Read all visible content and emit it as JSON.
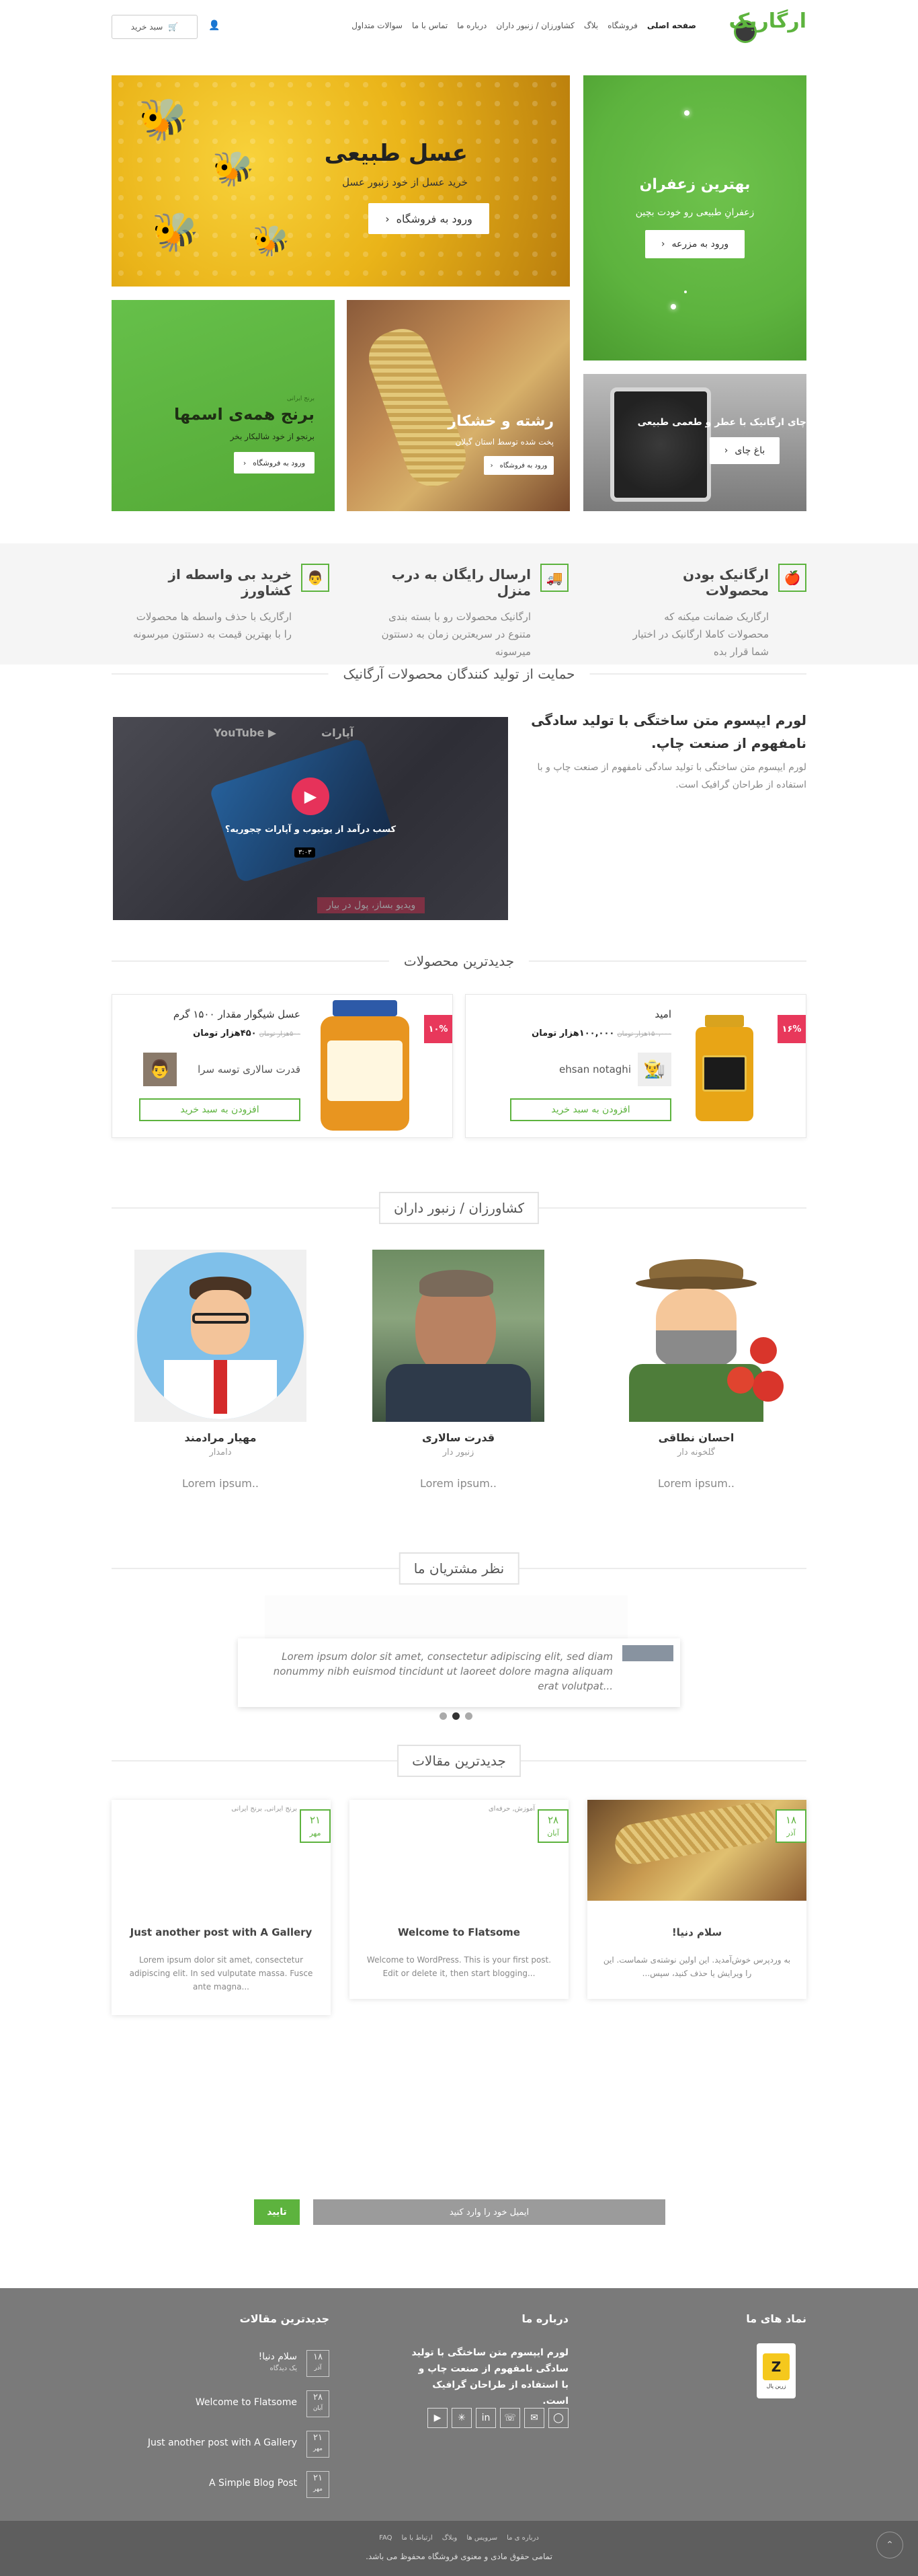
{
  "header": {
    "logo_text": "ارگاریک",
    "nav": [
      "صفحه اصلی",
      "فروشگاه",
      "بلاگ",
      "کشاورزان / زنبور داران",
      "درباره ما",
      "تماس با ما",
      "سوالات متداول"
    ],
    "cart_label": "سبد خرید"
  },
  "hero": {
    "honey": {
      "title": "عسل طبیعی",
      "subtitle": "خرید عسل از خود زنبور عسل",
      "button": "ورود به فروشگاه"
    },
    "saffron": {
      "title": "بهترین زعفران",
      "subtitle": "زعفرانِ طبیعی رو خودت بچین",
      "button": "ورود به مزرعه"
    },
    "tea": {
      "title": "چای ارگانیک با عطر و طعمی طبیعی",
      "button": "باغ چای"
    },
    "sweets": {
      "title": "رشته و خشکار",
      "subtitle": "پخت شده توسط استان گیلان",
      "button": "ورود به فروشگاه"
    },
    "rice": {
      "small": "برنج ایرانی",
      "title": "برنج همه‌ی اسمها",
      "subtitle": "برنجو از خود شالیکار بخر",
      "button": "ورود به فروشگاه"
    }
  },
  "features": [
    {
      "title": "ارگانیک بودن محصولات",
      "text": "ارگاریک ضمانت میکنه که محصولات کاملا ارگانیک در اختیار شما قرار بده",
      "icon": "apple-icon"
    },
    {
      "title": "ارسال رایگان به درب منزل",
      "text": "ارگانیک محصولات رو با بسته بندی متنوع در سریعترین زمان به دستتون میرسونه",
      "icon": "truck-icon"
    },
    {
      "title": "خرید بی واسطه از کشاورز",
      "text": "ارگاریک با حذف واسطه ها محصولات را با بهترین قیمت به دستتون میرسونه",
      "icon": "farmer-icon"
    }
  ],
  "support": {
    "section_title": "حمایت از تولید کنندگان محصولات آرگانیک",
    "heading": "لورم ایپسوم متن ساختگی با تولید سادگی نامفهوم از صنعت چاپ.",
    "text": "لورم ایپسوم متن ساختگی با تولید سادگی نامفهوم از صنعت چاپ و با استفاده از طراحان گرافیک است.",
    "video_title": "کسب درآمد از یوتیوب و آپارات چجوریه؟",
    "video_duration": "۳:۰۳",
    "video_banner": "ویدیو بساز، پول در بیار"
  },
  "products": {
    "section_title": "جدیدترین محصولات",
    "items": [
      {
        "badge": "۱۶%",
        "name": "امید",
        "price_old": "۱۵۰,۰۰۰هزار تومان",
        "price": "۱۰۰,۰۰۰هزار تومان",
        "seller": "ehsan notaghi",
        "button": "افزودن به سبد خرید"
      },
      {
        "badge": "۱۰%",
        "name": "عسل شیگوار مقدار ۱۵۰۰ گرم",
        "price_old": "۵۰۰هزار تومان",
        "price": "۴۵۰هزار تومان",
        "seller": "قدرت سالاری توسه سرا",
        "button": "افزودن به سبد خرید"
      }
    ]
  },
  "farmers": {
    "section_title": "کشاورزان / زنبور داران",
    "items": [
      {
        "name": "احسان نطاقی",
        "role": "گلخونه دار",
        "more": "Lorem ipsum.."
      },
      {
        "name": "قدرت سالاری",
        "role": "زنبور دار",
        "more": "Lorem ipsum.."
      },
      {
        "name": "مهیار مرادمند",
        "role": "دامدار",
        "more": "Lorem ipsum.."
      }
    ]
  },
  "testimonials": {
    "section_title": "نظر مشتریان ما",
    "quote": "Lorem ipsum dolor sit amet, consectetur adipiscing elit, sed diam nonummy nibh euismod tincidunt ut laoreet dolore magna aliquam erat volutpat..."
  },
  "articles": {
    "section_title": "جدیدترین مقالات",
    "items": [
      {
        "day": "۱۸",
        "month": "آذر",
        "category": "",
        "title": "سلام دنیا!",
        "excerpt": "به وردپرس خوش‌آمدید. این اولین نوشته‌ی شماست. این را ویرایش یا حذف کنید، سپس..."
      },
      {
        "day": "۲۸",
        "month": "آبان",
        "category": "آموزش, حرفه‌ای",
        "title": "Welcome to Flatsome",
        "excerpt": "Welcome to WordPress. This is your first post. Edit or delete it, then start blogging..."
      },
      {
        "day": "۲۱",
        "month": "مهر",
        "category": "برنج ایرانی, برنج ایرانی",
        "title": "Just another post with A Gallery",
        "excerpt": "Lorem ipsum dolor sit amet, consectetur adipiscing elit. In sed vulputate massa. Fusce ante magna..."
      }
    ]
  },
  "newsletter": {
    "placeholder": "ایمیل خود را وارد کنید",
    "button": "تایید"
  },
  "footer": {
    "col1_title": "نماد های ما",
    "col2_title": "درباره ما",
    "col2_text": "لورم ایپسوم متن ساختگی با تولید سادگی نامفهوم از صنعت چاپ و با استفاده از طراحان گرافیک است.",
    "col3_title": "جدیدترین مقالات",
    "posts": [
      {
        "day": "۱۸",
        "month": "آذر",
        "title": "سلام دنیا!",
        "comment": "یک دیدگاه"
      },
      {
        "day": "۲۸",
        "month": "آبان",
        "title": "Welcome to Flatsome",
        "comment": ""
      },
      {
        "day": "۲۱",
        "month": "مهر",
        "title": "Just another post with A Gallery",
        "comment": ""
      },
      {
        "day": "۲۱",
        "month": "مهر",
        "title": "A Simple Blog Post",
        "comment": ""
      }
    ],
    "links": [
      "درباره ی ما",
      "سرویس ها",
      "وبلاگ",
      "ارتباط با ما",
      "FAQ"
    ],
    "copyright": "تمامی حقوق مادی و معنوی فروشگاه محفوظ می باشد.",
    "badge_text": "زرین پال"
  },
  "colors": {
    "accent": "#5db33e",
    "badge": "#e8385b",
    "footer": "#7a7a7a"
  }
}
